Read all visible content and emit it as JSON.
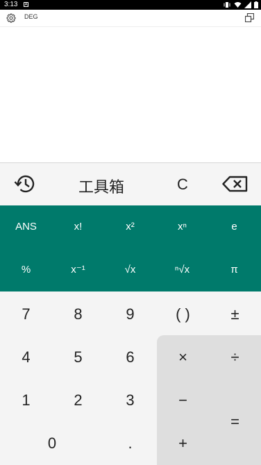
{
  "status_bar": {
    "time": "3:13",
    "notification_icon": "a-notification-icon",
    "vibrate_icon": "vibrate-icon",
    "wifi_icon": "wifi-icon",
    "signal_icon": "signal-icon",
    "battery_icon": "battery-icon"
  },
  "top_bar": {
    "settings_icon": "gear-icon",
    "angle_mode": "DEG",
    "window_icon": "floating-window-icon"
  },
  "history_row": {
    "history_icon": "history-icon",
    "toolbox_label": "工具箱",
    "clear_label": "C",
    "backspace_icon": "backspace-icon"
  },
  "scientific_keys": [
    {
      "label": "ANS"
    },
    {
      "label": "x!"
    },
    {
      "label": "x²"
    },
    {
      "label": "xⁿ"
    },
    {
      "label": "e"
    },
    {
      "label": "%"
    },
    {
      "label": "x⁻¹"
    },
    {
      "label": "√x"
    },
    {
      "label": "ⁿ√x"
    },
    {
      "label": "π"
    }
  ],
  "number_keys": [
    {
      "label": "7"
    },
    {
      "label": "8"
    },
    {
      "label": "9"
    },
    {
      "label": "( )"
    },
    {
      "label": "±"
    },
    {
      "label": "4"
    },
    {
      "label": "5"
    },
    {
      "label": "6"
    },
    {
      "label": "1"
    },
    {
      "label": "2"
    },
    {
      "label": "3"
    },
    {
      "label": "0"
    },
    {
      "label": "."
    }
  ],
  "operator_keys": [
    {
      "label": "×"
    },
    {
      "label": "÷"
    },
    {
      "label": "−"
    },
    {
      "label": "="
    },
    {
      "label": "+"
    }
  ],
  "colors": {
    "scientific_panel": "#007a6b",
    "operator_panel": "#dedede",
    "number_pad": "#f4f4f4"
  }
}
